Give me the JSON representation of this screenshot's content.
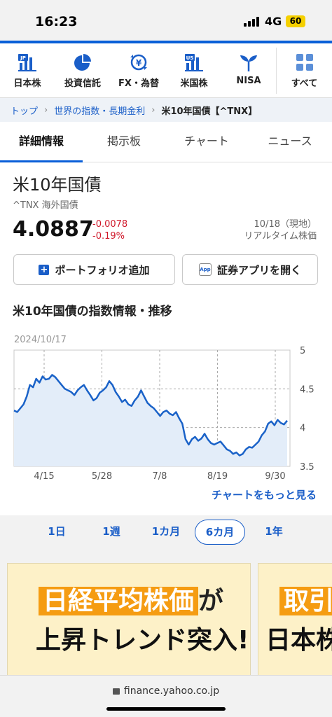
{
  "status": {
    "time": "16:23",
    "network": "4G",
    "battery": "60"
  },
  "nav": {
    "items": [
      {
        "label": "日本株",
        "icon": "jp-stock-icon",
        "badge": "JP"
      },
      {
        "label": "投資信託",
        "icon": "pie-chart-icon"
      },
      {
        "label": "FX・為替",
        "icon": "currency-exchange-icon"
      },
      {
        "label": "米国株",
        "icon": "us-stock-icon",
        "badge": "US"
      },
      {
        "label": "NISA",
        "icon": "sprout-icon"
      },
      {
        "label": "すべて",
        "icon": "grid-icon"
      }
    ]
  },
  "breadcrumb": {
    "items": [
      "トップ",
      "世界の指数・長期金利"
    ],
    "current": "米10年国債【^TNX】"
  },
  "tabs": [
    "詳細情報",
    "掲示板",
    "チャート",
    "ニュース"
  ],
  "quote": {
    "name": "米10年国債",
    "symbol_line": "^TNX 海外国債",
    "price": "4.0887",
    "change": "-0.0078",
    "change_pct": "-0.19%",
    "date": "10/18（現地）",
    "realtime": "リアルタイム株価"
  },
  "buttons": {
    "portfolio": "ポートフォリオ追加",
    "app": "証券アプリを開く",
    "app_badge": "App"
  },
  "section_title": "米10年国債の指数情報・推移",
  "chart_data": {
    "type": "area",
    "date_label": "2024/10/17",
    "y_ticks": [
      "5",
      "4.5",
      "4",
      "3.5"
    ],
    "ylim": [
      3.5,
      5
    ],
    "x_ticks": [
      "4/15",
      "5/28",
      "7/8",
      "8/19",
      "9/30"
    ],
    "values": [
      4.22,
      4.2,
      4.25,
      4.3,
      4.4,
      4.55,
      4.52,
      4.63,
      4.58,
      4.66,
      4.62,
      4.63,
      4.68,
      4.65,
      4.6,
      4.55,
      4.5,
      4.48,
      4.46,
      4.42,
      4.48,
      4.52,
      4.55,
      4.48,
      4.42,
      4.35,
      4.38,
      4.45,
      4.48,
      4.52,
      4.6,
      4.55,
      4.46,
      4.4,
      4.33,
      4.36,
      4.3,
      4.28,
      4.35,
      4.4,
      4.48,
      4.4,
      4.32,
      4.28,
      4.25,
      4.2,
      4.15,
      4.2,
      4.22,
      4.18,
      4.16,
      4.2,
      4.12,
      4.05,
      3.85,
      3.78,
      3.85,
      3.88,
      3.83,
      3.86,
      3.92,
      3.85,
      3.8,
      3.78,
      3.8,
      3.82,
      3.77,
      3.72,
      3.7,
      3.66,
      3.68,
      3.64,
      3.66,
      3.72,
      3.75,
      3.74,
      3.78,
      3.82,
      3.9,
      3.95,
      4.05,
      4.08,
      4.03,
      4.1,
      4.06,
      4.04,
      4.09
    ],
    "line_color": "#1a62c8",
    "fill_color": "#e3edf9",
    "grid": true
  },
  "more_link": "チャートをもっと見る",
  "periods": [
    "1日",
    "1週",
    "1カ月",
    "6カ月",
    "1年"
  ],
  "active_period": "6カ月",
  "ads": {
    "a": {
      "hl": "日経平均株価",
      "tail": "が",
      "line2": "上昇トレンド突入!?"
    },
    "b": {
      "hl": "取引",
      "line2": "日本株"
    }
  },
  "url": "finance.yahoo.co.jp"
}
